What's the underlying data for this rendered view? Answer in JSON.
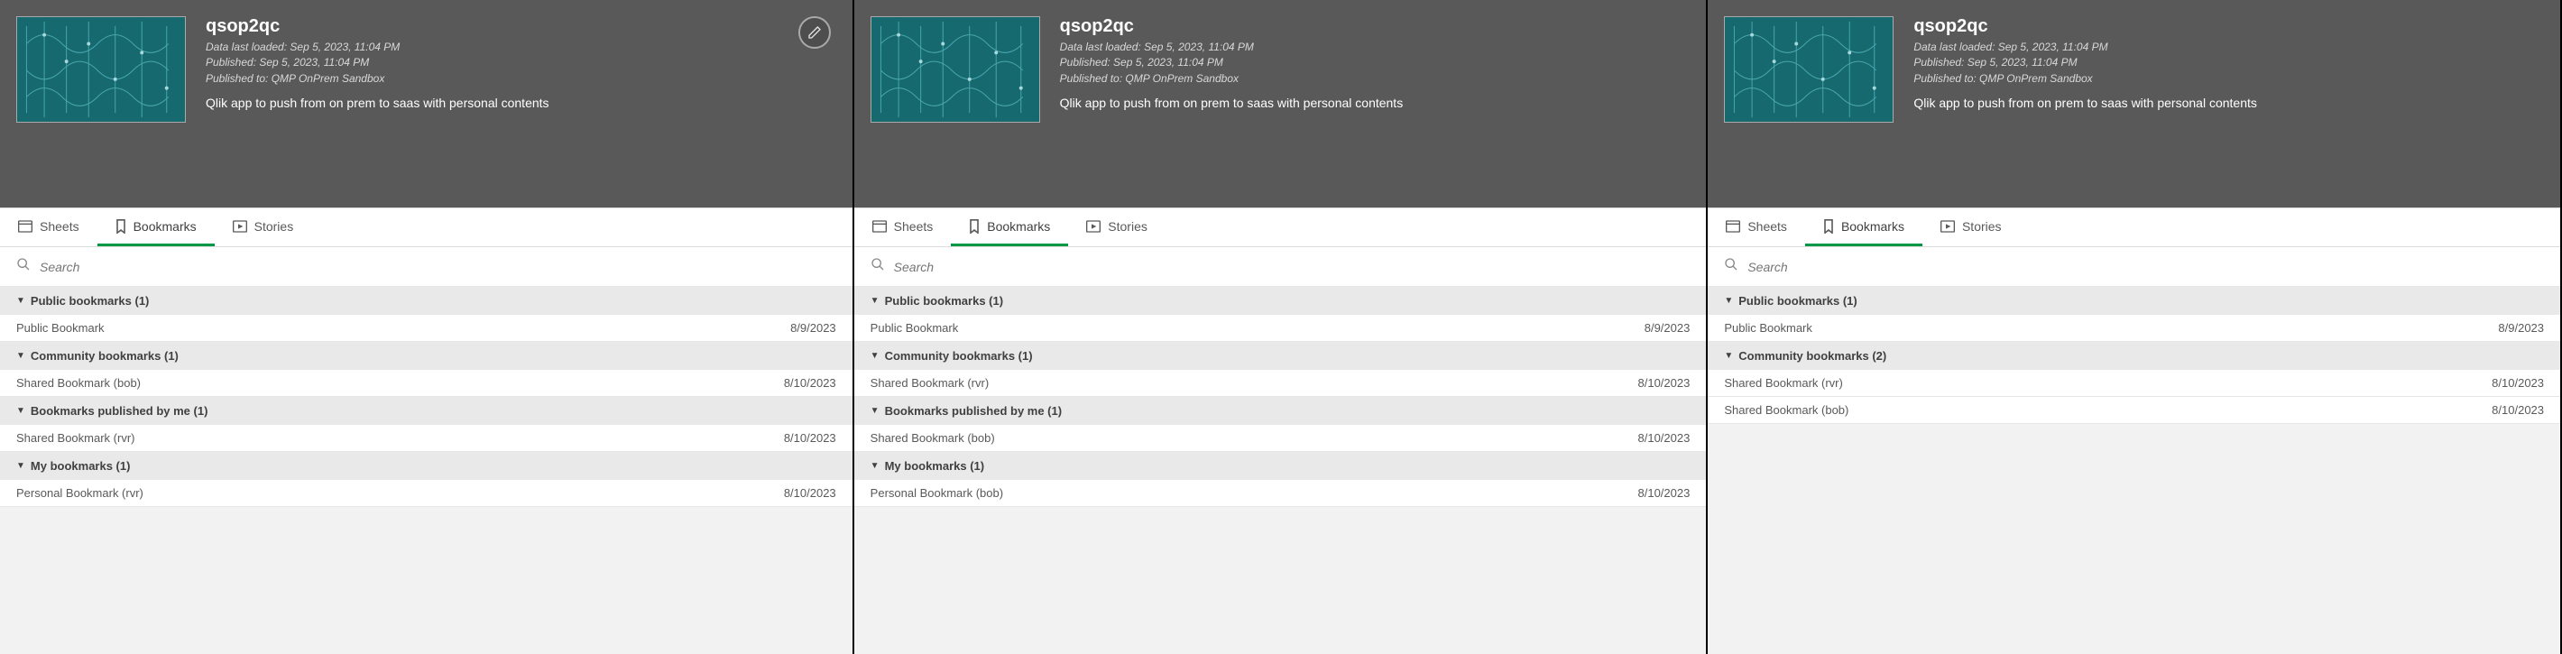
{
  "panes": [
    {
      "has_edit": true,
      "app_title": "qsop2qc",
      "loaded": "Data last loaded: Sep 5, 2023, 11:04 PM",
      "published": "Published: Sep 5, 2023, 11:04 PM",
      "pubto": "Published to: QMP OnPrem Sandbox",
      "desc": "Qlik app to push from on prem to saas with personal contents",
      "tabs": {
        "sheets": "Sheets",
        "bookmarks": "Bookmarks",
        "stories": "Stories"
      },
      "search_ph": "Search",
      "group0": {
        "label": "Public bookmarks (1)"
      },
      "group0_rows": [
        {
          "name": "Public Bookmark",
          "date": "8/9/2023"
        }
      ],
      "group1": {
        "label": "Community bookmarks (1)"
      },
      "group1_rows": [
        {
          "name": "Shared Bookmark (bob)",
          "date": "8/10/2023"
        }
      ],
      "group2": {
        "label": "Bookmarks published by me (1)"
      },
      "group2_rows": [
        {
          "name": "Shared Bookmark (rvr)",
          "date": "8/10/2023"
        }
      ],
      "group3": {
        "label": "My bookmarks (1)"
      },
      "group3_rows": [
        {
          "name": "Personal Bookmark (rvr)",
          "date": "8/10/2023"
        }
      ]
    },
    {
      "has_edit": false,
      "app_title": "qsop2qc",
      "loaded": "Data last loaded: Sep 5, 2023, 11:04 PM",
      "published": "Published: Sep 5, 2023, 11:04 PM",
      "pubto": "Published to: QMP OnPrem Sandbox",
      "desc": "Qlik app to push from on prem to saas with personal contents",
      "tabs": {
        "sheets": "Sheets",
        "bookmarks": "Bookmarks",
        "stories": "Stories"
      },
      "search_ph": "Search",
      "group0": {
        "label": "Public bookmarks (1)"
      },
      "group0_rows": [
        {
          "name": "Public Bookmark",
          "date": "8/9/2023"
        }
      ],
      "group1": {
        "label": "Community bookmarks (1)"
      },
      "group1_rows": [
        {
          "name": "Shared Bookmark (rvr)",
          "date": "8/10/2023"
        }
      ],
      "group2": {
        "label": "Bookmarks published by me (1)"
      },
      "group2_rows": [
        {
          "name": "Shared Bookmark (bob)",
          "date": "8/10/2023"
        }
      ],
      "group3": {
        "label": "My bookmarks (1)"
      },
      "group3_rows": [
        {
          "name": "Personal Bookmark (bob)",
          "date": "8/10/2023"
        }
      ]
    },
    {
      "has_edit": false,
      "app_title": "qsop2qc",
      "loaded": "Data last loaded: Sep 5, 2023, 11:04 PM",
      "published": "Published: Sep 5, 2023, 11:04 PM",
      "pubto": "Published to: QMP OnPrem Sandbox",
      "desc": "Qlik app to push from on prem to saas with personal contents",
      "tabs": {
        "sheets": "Sheets",
        "bookmarks": "Bookmarks",
        "stories": "Stories"
      },
      "search_ph": "Search",
      "group0": {
        "label": "Public bookmarks (1)"
      },
      "group0_rows": [
        {
          "name": "Public Bookmark",
          "date": "8/9/2023"
        }
      ],
      "group1": {
        "label": "Community bookmarks (2)"
      },
      "group1_rows": [
        {
          "name": "Shared Bookmark (rvr)",
          "date": "8/10/2023"
        },
        {
          "name": "Shared Bookmark (bob)",
          "date": "8/10/2023"
        }
      ],
      "group2": null,
      "group2_rows": [],
      "group3": null,
      "group3_rows": []
    }
  ]
}
